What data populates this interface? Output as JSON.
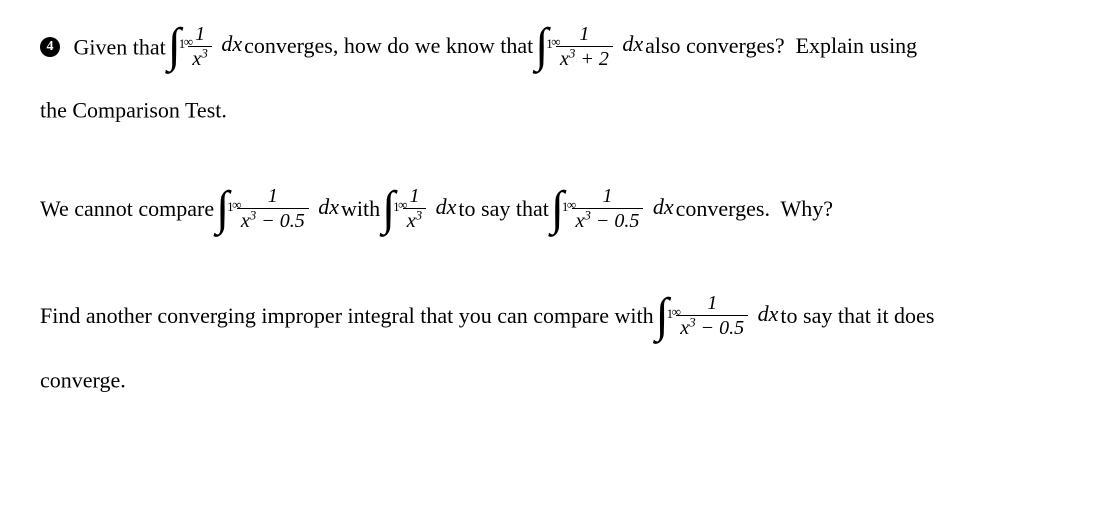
{
  "problem": {
    "number": "4",
    "p1a": "Given that",
    "p1b": "converges, how do we know that",
    "p1c": "also converges?  Explain using",
    "p1d": "the Comparison Test.",
    "p2a": "We cannot compare",
    "p2b": "with",
    "p2c": "to say that",
    "p2d": "converges.  Why?",
    "p3a": "Find another converging improper integral that you can compare with",
    "p3b": "to say that it does",
    "p3c": "converge."
  },
  "math": {
    "inf": "∞",
    "one": "1",
    "x": "x",
    "cubed": "3",
    "plus2": "+ 2",
    "minus05": "− 0.5",
    "dx": "dx"
  }
}
